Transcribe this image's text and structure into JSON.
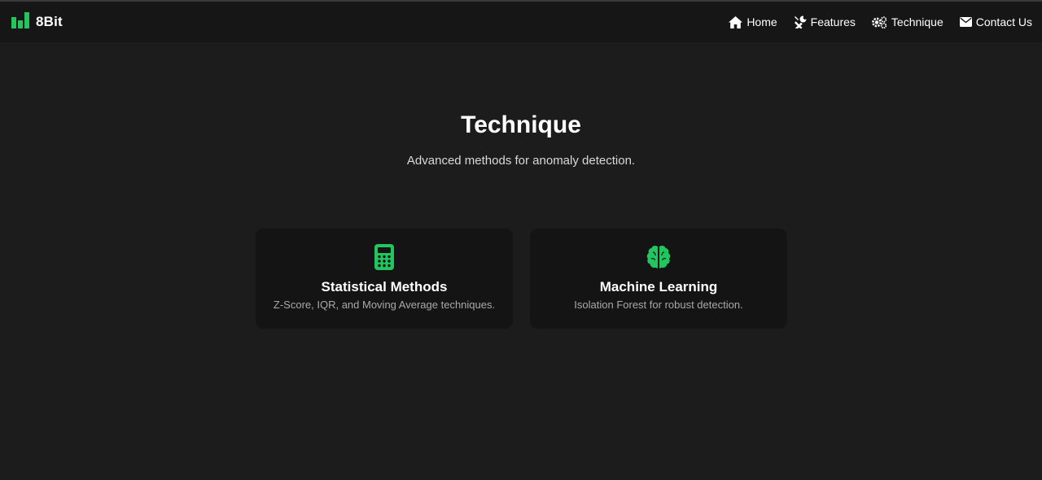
{
  "brand": {
    "name": "8Bit",
    "logo_icon": "bar-chart-icon",
    "accent": "#22c55e"
  },
  "nav": {
    "items": [
      {
        "label": "Home",
        "icon": "home-icon"
      },
      {
        "label": "Features",
        "icon": "tools-icon"
      },
      {
        "label": "Technique",
        "icon": "gears-icon"
      },
      {
        "label": "Contact Us",
        "icon": "envelope-icon"
      }
    ]
  },
  "hero": {
    "title": "Technique",
    "subtitle": "Advanced methods for anomaly detection."
  },
  "cards": [
    {
      "icon": "calculator-icon",
      "title": "Statistical Methods",
      "description": "Z-Score, IQR, and Moving Average techniques."
    },
    {
      "icon": "brain-icon",
      "title": "Machine Learning",
      "description": "Isolation Forest for robust detection."
    }
  ],
  "colors": {
    "background": "#1c1c1c",
    "navbar": "#161616",
    "card": "#141414",
    "accent": "#22c55e"
  }
}
